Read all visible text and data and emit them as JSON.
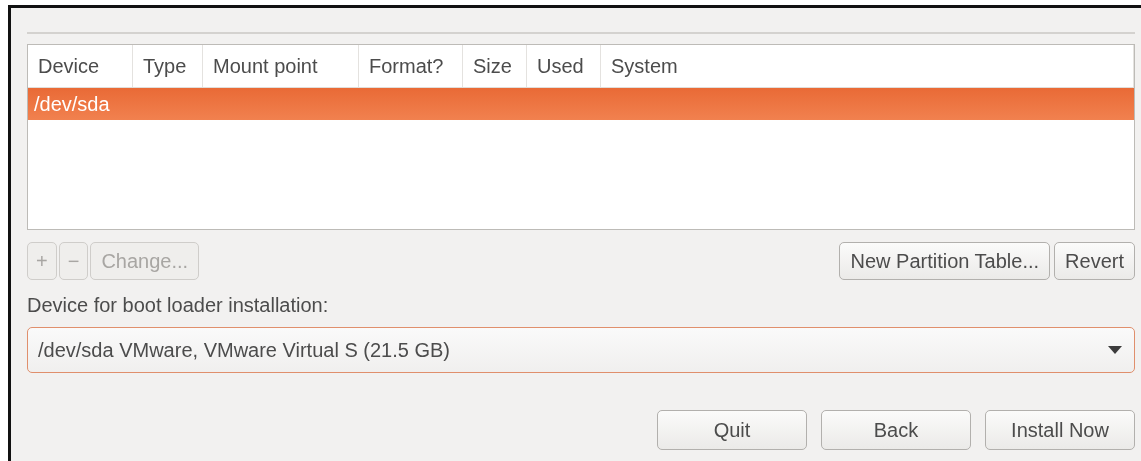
{
  "table": {
    "columns": [
      "Device",
      "Type",
      "Mount point",
      "Format?",
      "Size",
      "Used",
      "System"
    ],
    "rows": [
      {
        "cells": [
          "/dev/sda"
        ],
        "selected": true
      }
    ]
  },
  "partition_buttons": [
    {
      "label": "+",
      "disabled": true
    },
    {
      "label": "−",
      "disabled": true
    },
    {
      "label": "Change...",
      "disabled": true
    }
  ],
  "table_buttons": [
    {
      "label": "New Partition Table...",
      "disabled": false
    },
    {
      "label": "Revert",
      "disabled": false
    }
  ],
  "boot_loader": {
    "label": "Device for boot loader installation:",
    "value": "/dev/sda VMware, VMware Virtual S (21.5 GB)"
  },
  "footer_buttons": [
    {
      "label": "Quit"
    },
    {
      "label": "Back"
    },
    {
      "label": "Install Now"
    }
  ]
}
